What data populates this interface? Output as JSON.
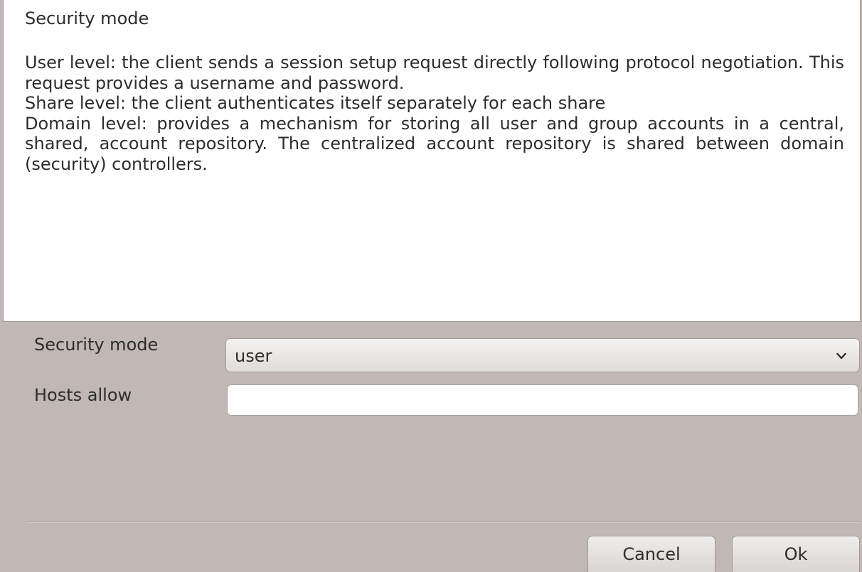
{
  "help": {
    "title": "Security mode",
    "paragraphs": [
      "User level: the client sends a session setup request directly following protocol negotiation. This request provides a username and password.",
      "Share level: the client authenticates itself separately for each share",
      "Domain level: provides a mechanism for storing all user and group accounts in a central, shared, account repository. The centralized account repository is shared between domain (security) controllers."
    ]
  },
  "form": {
    "security_mode_label": "Security mode",
    "security_mode_value": "user",
    "hosts_allow_label": "Hosts allow",
    "hosts_allow_value": ""
  },
  "buttons": {
    "cancel": "Cancel",
    "ok": "Ok"
  },
  "icons": {
    "dropdown": "chevron-down-icon"
  }
}
